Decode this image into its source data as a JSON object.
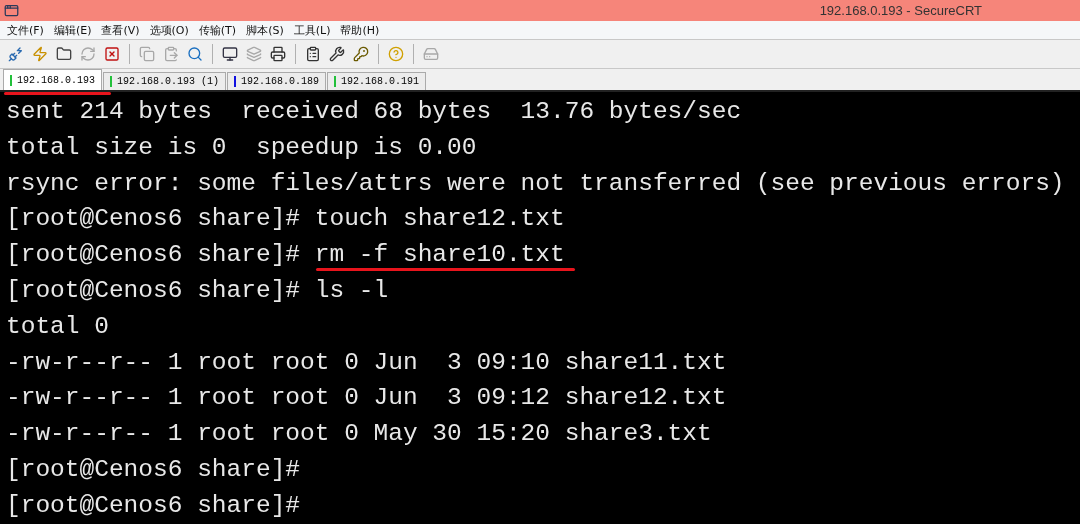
{
  "window": {
    "title": "192.168.0.193 - SecureCRT"
  },
  "menu": [
    "文件(F)",
    "编辑(E)",
    "查看(V)",
    "选项(O)",
    "传输(T)",
    "脚本(S)",
    "工具(L)",
    "帮助(H)"
  ],
  "toolbar": [
    {
      "kind": "connect",
      "disabled": false
    },
    {
      "kind": "quick-connect",
      "disabled": false
    },
    {
      "kind": "folder",
      "disabled": false
    },
    {
      "kind": "reconnect",
      "disabled": true
    },
    {
      "kind": "disconnect",
      "disabled": false
    },
    {
      "kind": "separator"
    },
    {
      "kind": "copy",
      "disabled": true
    },
    {
      "kind": "paste",
      "disabled": true
    },
    {
      "kind": "find",
      "disabled": false
    },
    {
      "kind": "separator"
    },
    {
      "kind": "print-setup",
      "disabled": false
    },
    {
      "kind": "tile",
      "disabled": true
    },
    {
      "kind": "print",
      "disabled": false
    },
    {
      "kind": "separator"
    },
    {
      "kind": "properties",
      "disabled": false
    },
    {
      "kind": "map-keys",
      "disabled": false
    },
    {
      "kind": "key",
      "disabled": false
    },
    {
      "kind": "separator"
    },
    {
      "kind": "help",
      "disabled": false
    },
    {
      "kind": "separator"
    },
    {
      "kind": "sftp",
      "disabled": true
    }
  ],
  "tabs": [
    {
      "label": "192.168.0.193",
      "selected": true,
      "color": "#22c03a",
      "underlined": true
    },
    {
      "label": "192.168.0.193 (1)",
      "selected": false,
      "color": "#22c03a",
      "underlined": false
    },
    {
      "label": "192.168.0.189",
      "selected": false,
      "color": "#1010e0",
      "underlined": false
    },
    {
      "label": "192.168.0.191",
      "selected": false,
      "color": "#22c03a",
      "underlined": false
    }
  ],
  "terminal": [
    {
      "text": "sent 214 bytes  received 68 bytes  13.76 bytes/sec",
      "underlined": false
    },
    {
      "text": "total size is 0  speedup is 0.00",
      "underlined": false
    },
    {
      "text": "rsync error: some files/attrs were not transferred (see previous errors)",
      "underlined": false
    },
    {
      "text": "[root@Cenos6 share]# touch share12.txt",
      "underlined": false
    },
    {
      "text": "[root@Cenos6 share]# rm -f share10.txt",
      "underlined": true
    },
    {
      "text": "[root@Cenos6 share]# ls -l",
      "underlined": false
    },
    {
      "text": "total 0",
      "underlined": false
    },
    {
      "text": "-rw-r--r-- 1 root root 0 Jun  3 09:10 share11.txt",
      "underlined": false
    },
    {
      "text": "-rw-r--r-- 1 root root 0 Jun  3 09:12 share12.txt",
      "underlined": false
    },
    {
      "text": "-rw-r--r-- 1 root root 0 May 30 15:20 share3.txt",
      "underlined": false
    },
    {
      "text": "[root@Cenos6 share]#",
      "underlined": false
    },
    {
      "text": "[root@Cenos6 share]#",
      "underlined": false
    }
  ]
}
